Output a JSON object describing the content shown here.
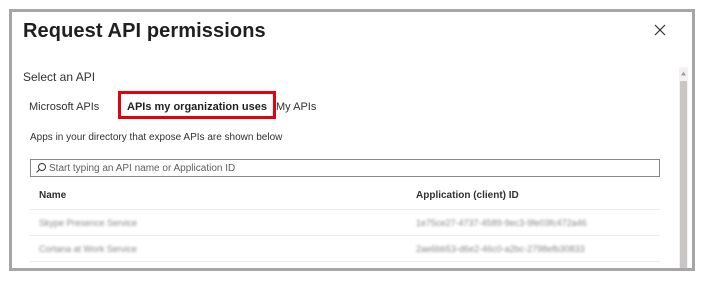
{
  "dialog": {
    "title": "Request API permissions",
    "close_icon": "close-icon"
  },
  "select_api": {
    "label": "Select an API"
  },
  "tabs": [
    {
      "label": "Microsoft APIs",
      "selected": false
    },
    {
      "label": "APIs my organization uses",
      "selected": true,
      "highlight_color": "#e3000f"
    },
    {
      "label": "My APIs",
      "selected": false
    }
  ],
  "description": "Apps in your directory that expose APIs are shown below",
  "search": {
    "placeholder": "Start typing an API name or Application ID",
    "value": "",
    "icon": "search-icon"
  },
  "table": {
    "columns": [
      "Name",
      "Application (client) ID"
    ],
    "rows": [
      {
        "name": "Skype Presence Service",
        "app_id": "1e75ce27-4737-4589-9ec3-9fe03fc472a46",
        "blurred": true
      },
      {
        "name": "Cortana at Work Service",
        "app_id": "2ae6bb53-d6e2-46c0-a2bc-2798efb30833",
        "blurred": true
      }
    ]
  },
  "colors": {
    "highlight_border": "#e3000f",
    "panel_border": "#a6a6a6"
  }
}
